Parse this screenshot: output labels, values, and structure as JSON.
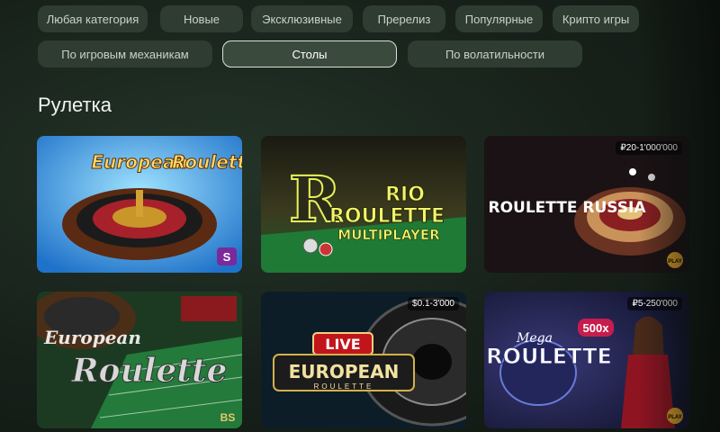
{
  "filters": {
    "row1": [
      "Любая категория",
      "Новые",
      "Эксклюзивные",
      "Пререлиз",
      "Популярные",
      "Крипто игры"
    ],
    "row2": [
      "По игровым механикам",
      "Столы",
      "По волатильности"
    ]
  },
  "section": {
    "title": "Рулетка"
  },
  "games": [
    {
      "title_line1": "European",
      "title_line2": "Roulette",
      "provider_badge": "S"
    },
    {
      "title_line1": "RIO",
      "title_line2": "ROULETTE",
      "title_line3": "MULTIPLAYER"
    },
    {
      "title": "ROULETTE RUSSIA",
      "limit": "₽20-1'000'000",
      "provider_badge": "PLAY"
    },
    {
      "title_line1": "European",
      "title_line2": "Roulette",
      "provider_badge": "BS"
    },
    {
      "badge": "LIVE",
      "title": "EUROPEAN",
      "subtitle": "ROULETTE",
      "limit": "$0.1-3'000"
    },
    {
      "title_line1": "Mega",
      "title_line2": "ROULETTE",
      "multiplier": "500x",
      "limit": "₽5-250'000",
      "provider_badge": "PLAY"
    }
  ]
}
